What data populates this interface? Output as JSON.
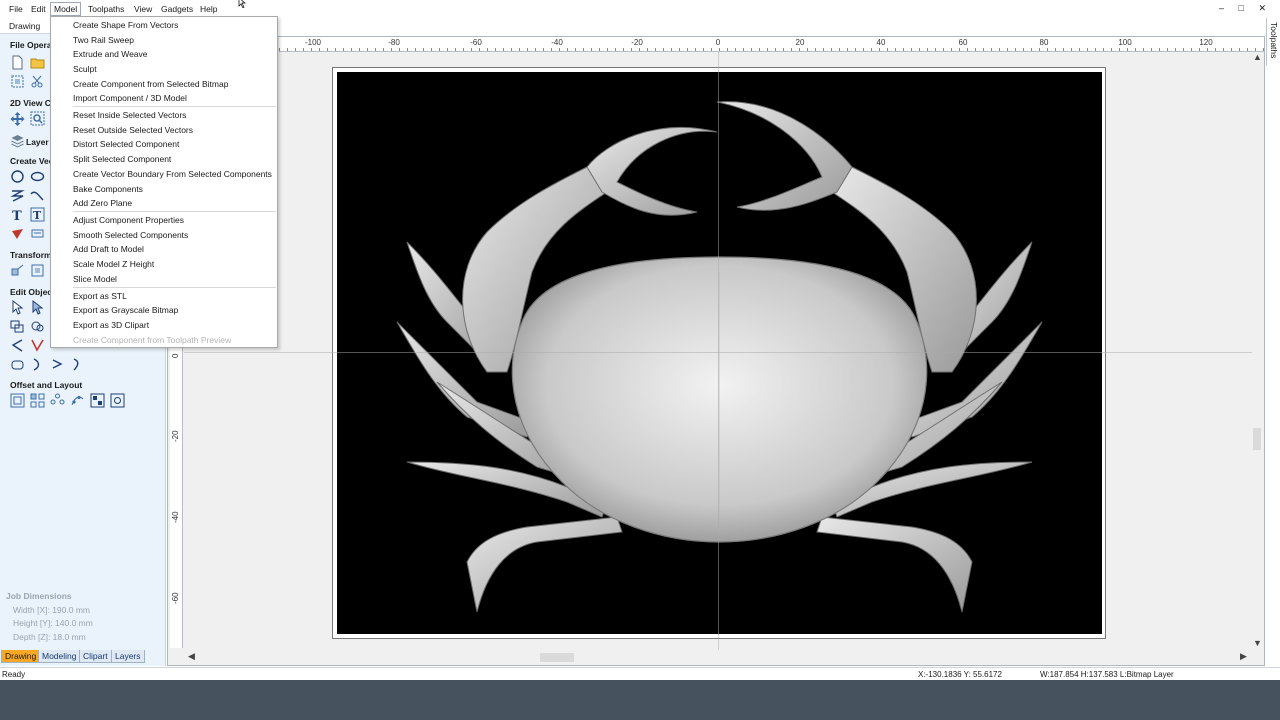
{
  "menubar": {
    "items": [
      "File",
      "Edit",
      "Model",
      "Toolpaths",
      "View",
      "Gadgets",
      "Help"
    ],
    "active": "Model",
    "window_controls": "– □ ✕"
  },
  "sidebar": {
    "top_tab": "Drawing",
    "sections": {
      "file_ops": "File Operat",
      "view2d": "2D View C",
      "layers_button": "Layer",
      "create_vectors": "Create Vec",
      "transform": "Transform",
      "edit_objects": "Edit Object",
      "offset_layout": "Offset and Layout"
    },
    "job_dimensions": {
      "title": "Job Dimensions",
      "width": "Width  [X]: 190.0 mm",
      "height": "Height [Y]: 140.0 mm",
      "depth": "Depth  [Z]: 18.0 mm"
    },
    "bottom_tabs": [
      "Drawing",
      "Modeling",
      "Clipart",
      "Layers"
    ],
    "active_bottom_tab": "Drawing"
  },
  "right_panel_tab": "Toolpaths",
  "model_menu": {
    "groups": [
      [
        "Create Shape From Vectors",
        "Two Rail Sweep",
        "Extrude and Weave",
        "Sculpt",
        "Create Component from Selected Bitmap",
        "Import Component / 3D Model"
      ],
      [
        "Reset Inside Selected Vectors",
        "Reset Outside Selected Vectors",
        "Distort Selected Component",
        "Split Selected Component",
        "Create Vector Boundary From Selected Components",
        "Bake Components",
        "Add Zero Plane"
      ],
      [
        "Adjust Component Properties",
        "Smooth Selected Components",
        "Add Draft to Model",
        "Scale Model Z Height",
        "Slice Model"
      ],
      [
        "Export as STL",
        "Export as Grayscale Bitmap",
        "Export as 3D Clipart"
      ]
    ],
    "disabled_item": "Create Component from Toolpath Preview"
  },
  "ruler": {
    "top_labels": [
      "-100",
      "-80",
      "-60",
      "-40",
      "-20",
      "0",
      "20",
      "40",
      "60",
      "80",
      "100",
      "120"
    ],
    "left_labels": [
      "0",
      "-20",
      "-40",
      "-60"
    ]
  },
  "status": {
    "left": "Ready",
    "coords": "X:-130.1836 Y: 55.6172",
    "info": "W:187.854  H:137.583  L:Bitmap Layer"
  },
  "colors": {
    "sidebar_bg": "#eaf3fb",
    "active_tab": "#f9a825",
    "taskbar": "#46535f",
    "bitmap_bg": "#000000"
  }
}
